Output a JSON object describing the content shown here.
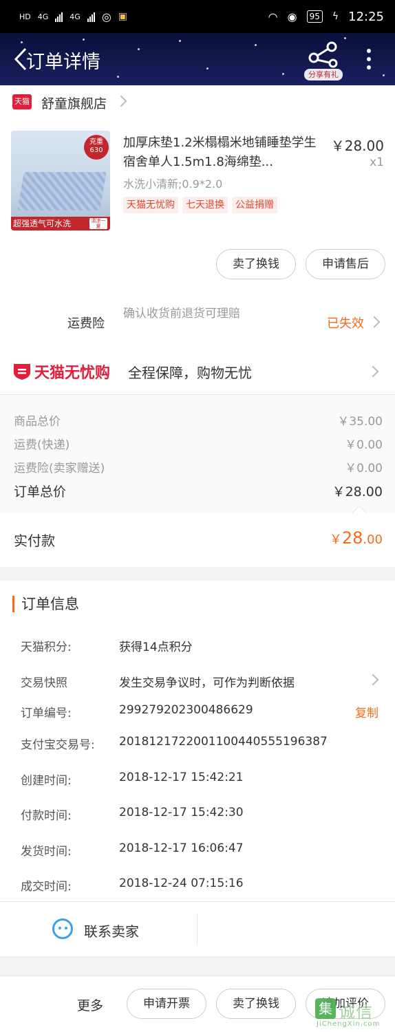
{
  "status_bar": {
    "net_labels": [
      "HD",
      "4G",
      "4G"
    ],
    "battery": "95",
    "time": "12:25"
  },
  "nav": {
    "title": "订单详情",
    "share_label": "分享有礼"
  },
  "shop": {
    "badge": "天猫",
    "name": "舒童旗舰店"
  },
  "product": {
    "title": "加厚床垫1.2米榻榻米地铺睡垫学生宿舍单人1.5m1.8海绵垫...",
    "price": "￥28.00",
    "qty": "x1",
    "sku": "水洗小清新;0.9*2.0",
    "tags": [
      "天猫无忧购",
      "七天退换",
      "公益捐赠"
    ],
    "image_weight_label": "克重",
    "image_weight_value": "630",
    "image_banner": "超强透气可水洗",
    "image_banner_tag": "清凉一夏",
    "actions": [
      "卖了换钱",
      "申请售后"
    ]
  },
  "insurance": {
    "label": "运费险",
    "desc": "确认收货前退货可理赔",
    "status": "已失效"
  },
  "tmall_care": {
    "logo": "天猫无忧购",
    "text": "全程保障，购物无忧"
  },
  "price_summary": {
    "rows": [
      {
        "label": "商品总价",
        "value": "￥35.00"
      },
      {
        "label": "运费(快递)",
        "value": "￥0.00"
      },
      {
        "label": "运费险(卖家赠送)",
        "value": "￥0.00"
      }
    ],
    "total_label": "订单总价",
    "total_value": "￥28.00",
    "paid_label": "实付款",
    "paid_currency": "￥",
    "paid_int": "28",
    "paid_dec": ".00"
  },
  "order_info": {
    "title": "订单信息",
    "rows": [
      {
        "label": "天猫积分:",
        "value": "获得14点积分"
      },
      {
        "label": "交易快照",
        "value": "发生交易争议时，可作为判断依据"
      },
      {
        "label": "订单编号:",
        "value": "299279202300486629"
      },
      {
        "label": "支付宝交易号:",
        "value": "2018121722001100440555196387"
      },
      {
        "label": "创建时间:",
        "value": "2018-12-17 15:42:21"
      },
      {
        "label": "付款时间:",
        "value": "2018-12-17 15:42:30"
      },
      {
        "label": "发货时间:",
        "value": "2018-12-17 16:06:47"
      },
      {
        "label": "成交时间:",
        "value": "2018-12-24 07:15:16"
      }
    ],
    "copy_label": "复制",
    "contact_label": "联系卖家"
  },
  "bottom_bar": {
    "more": "更多",
    "buttons": [
      "申请开票",
      "卖了换钱",
      "追加评价"
    ]
  },
  "watermark": {
    "box": "集",
    "text": "诚信",
    "url": "JiChengXin.com"
  },
  "colors": {
    "accent": "#f56b1a",
    "tmall_red": "#e21e3b",
    "nav_bg": "#0a0f3a"
  }
}
